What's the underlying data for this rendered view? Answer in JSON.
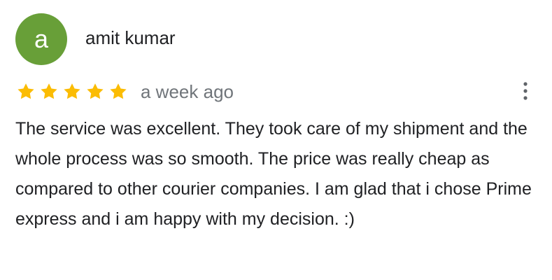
{
  "reviewer": {
    "avatar_letter": "a",
    "name": "amit kumar",
    "avatar_color": "#689f38"
  },
  "rating": {
    "value": 5,
    "max": 5,
    "star_color": "#fbbc04"
  },
  "review": {
    "time": "a week ago",
    "text": "The service was excellent. They took care of my shipment and the whole process was so smooth. The price was really cheap as compared to other courier companies. I am glad that i chose Prime express and i am happy with my decision. :)"
  },
  "actions": {
    "more_icon": "more-vert-icon"
  }
}
